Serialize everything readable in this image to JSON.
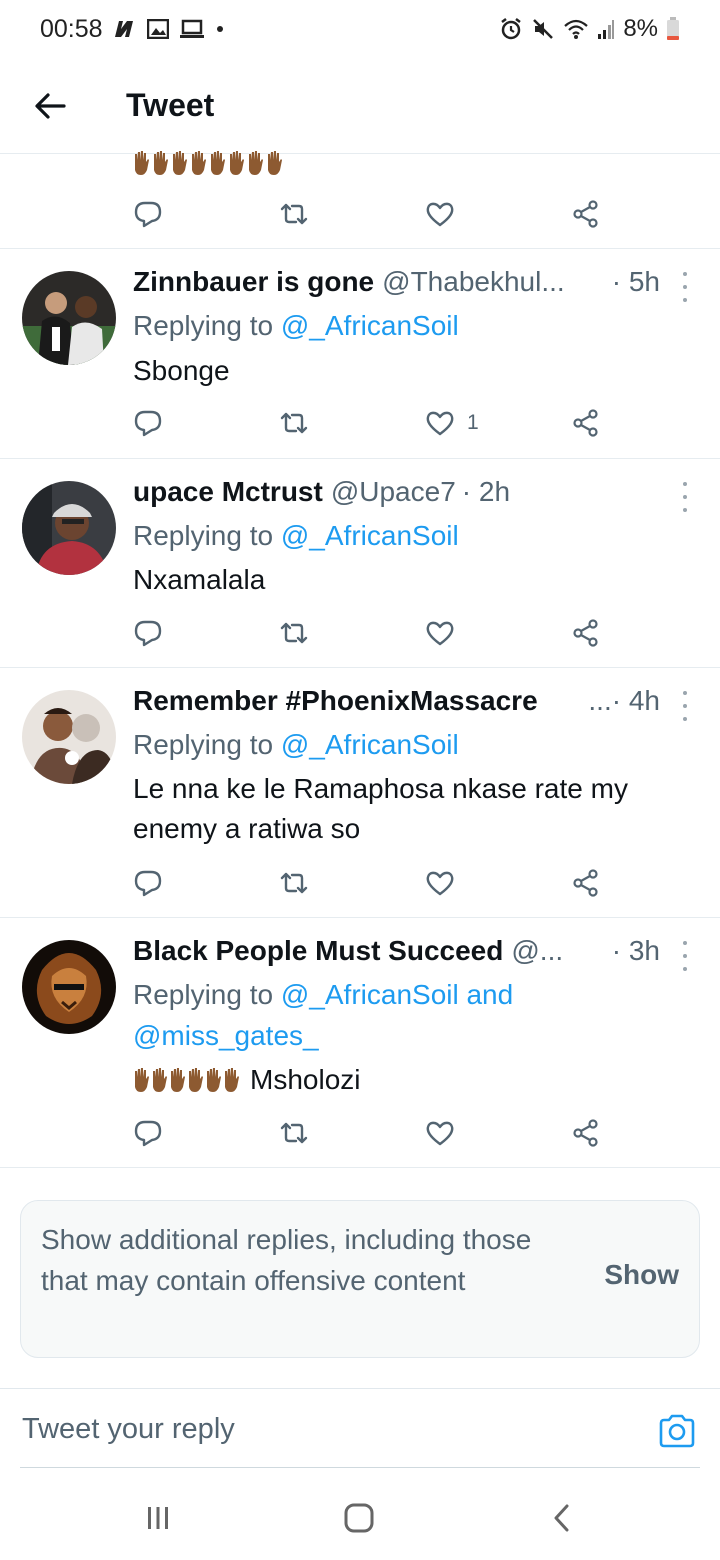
{
  "status_bar": {
    "time": "00:58",
    "battery": "8%",
    "left_icons": [
      "netflix-icon",
      "gallery-icon",
      "laptop-icon",
      "dot-icon"
    ],
    "right_icons": [
      "alarm-icon",
      "mute-icon",
      "wifi-icon",
      "signal-icon",
      "battery-icon"
    ]
  },
  "header": {
    "title": "Tweet"
  },
  "actions_labels": {
    "reply": "reply-icon",
    "retweet": "retweet-icon",
    "like": "heart-icon",
    "share": "share-icon"
  },
  "tweets": [
    {
      "name": "Zinnbauer is gone",
      "handle": "@Thabekhul...",
      "time": "· 5h",
      "replying_prefix": "Replying to",
      "replying_to": "@_AfricanSoil",
      "text": "Sbonge",
      "like_count": "1"
    },
    {
      "name": "upace Mctrust",
      "handle": "@Upace7",
      "time": "· 2h",
      "replying_prefix": "Replying to",
      "replying_to": "@_AfricanSoil",
      "text": "Nxamalala",
      "like_count": ""
    },
    {
      "name": "Remember #PhoenixMassacre",
      "handle": "",
      "time": "...· 4h",
      "replying_prefix": "Replying to",
      "replying_to": "@_AfricanSoil",
      "text": "Le nna ke le Ramaphosa nkase rate my enemy a ratiwa so",
      "like_count": ""
    },
    {
      "name": "Black People Must Succeed",
      "handle": "@...",
      "time": "· 3h",
      "replying_prefix": "Replying to",
      "replying_to": "@_AfricanSoil and @miss_gates_",
      "text": "Msholozi",
      "like_count": ""
    }
  ],
  "show_more": {
    "text": "Show additional replies, including those that may contain offensive content",
    "button": "Show"
  },
  "composer": {
    "placeholder": "Tweet your reply"
  },
  "colors": {
    "accent": "#1d9bf0",
    "secondary_text": "#536471",
    "divider": "#e6ecf0"
  }
}
